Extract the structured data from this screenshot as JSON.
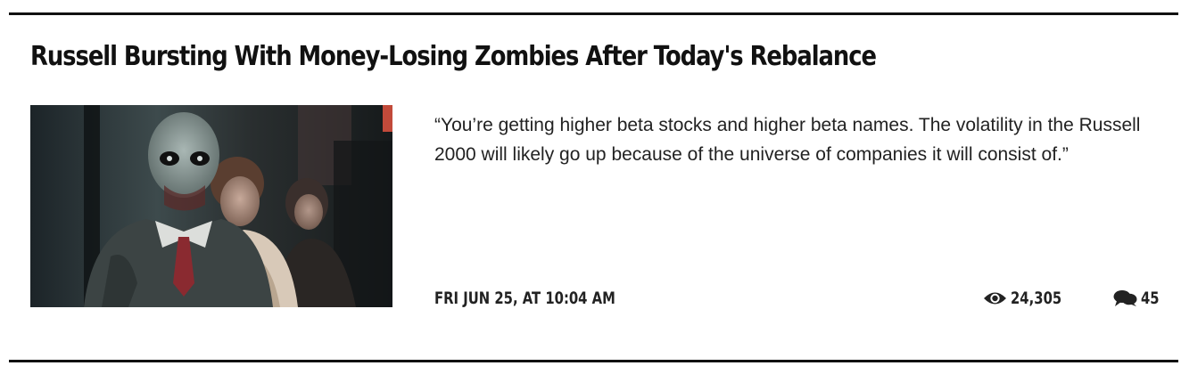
{
  "article": {
    "title": "Russell Bursting With Money-Losing Zombies After Today's Rebalance",
    "teaser": "“You’re getting higher beta stocks and higher beta names. The volatility in the Russell 2000 will likely go up because of the universe of companies it will consist of.”",
    "date": "FRI JUN 25, AT 10:04 AM",
    "views": "24,305",
    "comments": "45",
    "image_icon": "zombie-photo",
    "views_icon": "eye-icon",
    "comments_icon": "speech-bubbles-icon"
  }
}
